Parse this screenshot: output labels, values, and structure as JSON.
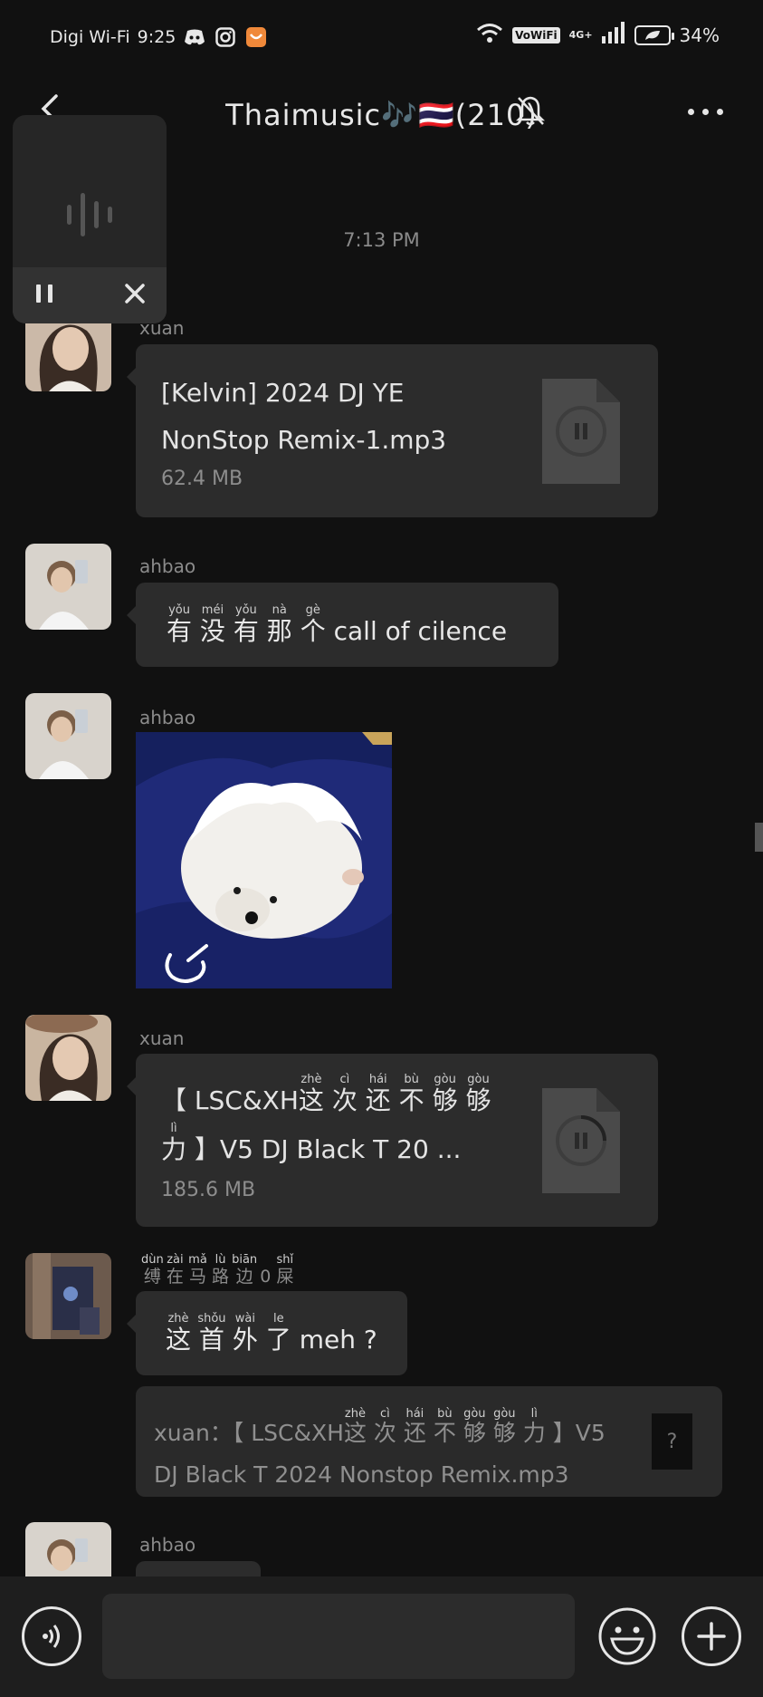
{
  "status_bar": {
    "carrier": "Digi Wi-Fi",
    "time": "9:25",
    "vowifi_label": "VoWiFi",
    "network_label": "4G+",
    "battery": "34%"
  },
  "header": {
    "title": "Thaimusic🎶🇹🇭(210)"
  },
  "timestamp": "7:13 PM",
  "messages": [
    {
      "sender": "xuan",
      "file_name": "[Kelvin] 2024 DJ YE NonStop Remix-1.mp3",
      "file_size": "62.4 MB"
    },
    {
      "sender": "ahbao",
      "text_plain": "有没有那个 call of cilence",
      "ruby": [
        {
          "char": "有",
          "pinyin": "yǒu"
        },
        {
          "char": "没",
          "pinyin": "méi"
        },
        {
          "char": "有",
          "pinyin": "yǒu"
        },
        {
          "char": "那",
          "pinyin": "nà"
        },
        {
          "char": "个",
          "pinyin": "gè"
        }
      ],
      "text_tail": "call of cilence"
    },
    {
      "sender": "ahbao",
      "type": "image"
    },
    {
      "sender": "xuan",
      "file_name_line1_prefix": "【 LSC&XH",
      "file_name_ruby": [
        {
          "char": "这",
          "pinyin": "zhè"
        },
        {
          "char": "次",
          "pinyin": "cì"
        },
        {
          "char": "还",
          "pinyin": "hái"
        },
        {
          "char": "不",
          "pinyin": "bù"
        },
        {
          "char": "够",
          "pinyin": "gòu"
        },
        {
          "char": "够",
          "pinyin": "gòu"
        }
      ],
      "file_name_line2_char": "力",
      "file_name_line2_pinyin": "lì",
      "file_name_line2_rest": " 】V5 DJ Black T 20 ...",
      "file_size": "185.6 MB"
    },
    {
      "sender_ruby": [
        {
          "char": "缚",
          "pinyin": "dùn"
        },
        {
          "char": "在",
          "pinyin": "zài"
        },
        {
          "char": "马",
          "pinyin": "mǎ"
        },
        {
          "char": "路",
          "pinyin": "lù"
        },
        {
          "char": "边",
          "pinyin": "biān"
        },
        {
          "char": "0",
          "pinyin": ""
        },
        {
          "char": "屎",
          "pinyin": "shǐ"
        }
      ],
      "text_ruby": [
        {
          "char": "这",
          "pinyin": "zhè"
        },
        {
          "char": "首",
          "pinyin": "shǒu"
        },
        {
          "char": "外",
          "pinyin": "wài"
        },
        {
          "char": "了",
          "pinyin": "le"
        }
      ],
      "text_tail": "meh ?",
      "quote": {
        "prefix": "xuan：【 LSC&XH",
        "ruby": [
          {
            "char": "这",
            "pinyin": "zhè"
          },
          {
            "char": "次",
            "pinyin": "cì"
          },
          {
            "char": "还",
            "pinyin": "hái"
          },
          {
            "char": "不",
            "pinyin": "bù"
          },
          {
            "char": "够",
            "pinyin": "gòu"
          },
          {
            "char": "够",
            "pinyin": "gòu"
          },
          {
            "char": "力",
            "pinyin": "lì"
          }
        ],
        "suffix": " 】V5",
        "line2": "DJ Black T 2024 Nonstop Remix.mp3",
        "icon_glyph": "?"
      }
    },
    {
      "sender": "ahbao"
    }
  ],
  "colors": {
    "background": "#111111",
    "bubble": "#2c2c2c",
    "input_bar": "#1e1e1e"
  },
  "icons": [
    "back-icon",
    "mute-bell-icon",
    "more-icon",
    "pause-icon",
    "close-icon",
    "file-pause-icon",
    "loading-icon",
    "voice-icon",
    "emoji-icon",
    "plus-icon"
  ]
}
